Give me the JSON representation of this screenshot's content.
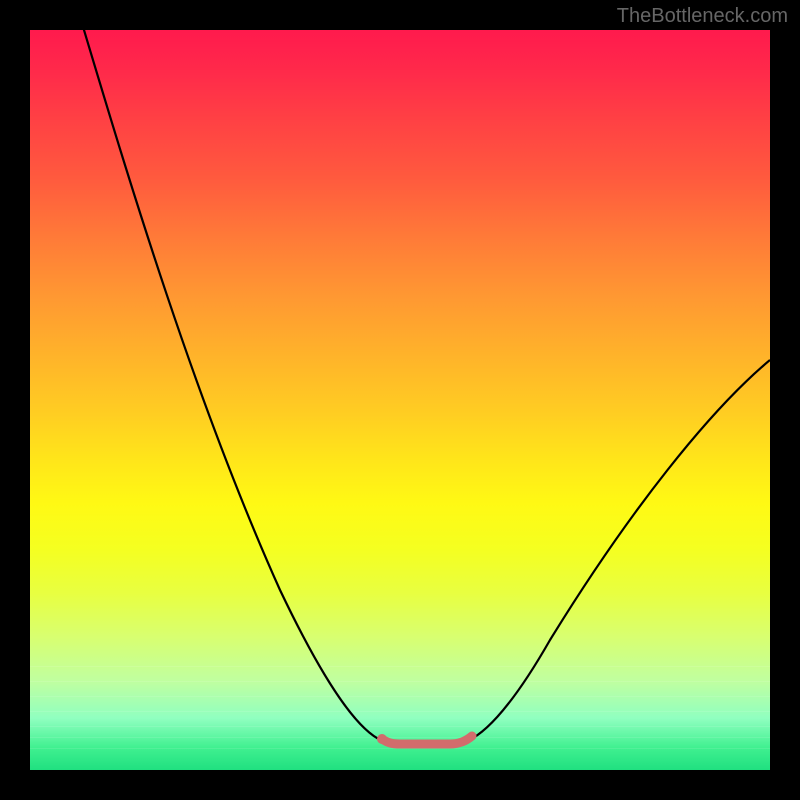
{
  "watermark": "TheBottleneck.com",
  "chart_data": {
    "type": "line",
    "title": "",
    "xlabel": "",
    "ylabel": "",
    "ylim": [
      0,
      100
    ],
    "x": [
      0.0,
      0.05,
      0.1,
      0.15,
      0.2,
      0.25,
      0.3,
      0.35,
      0.4,
      0.45,
      0.48,
      0.5,
      0.55,
      0.58,
      0.6,
      0.65,
      0.7,
      0.75,
      0.8,
      0.85,
      0.9,
      0.95,
      1.0
    ],
    "series": [
      {
        "name": "curve",
        "values": [
          120,
          100,
          84,
          68,
          54,
          42,
          31,
          22,
          14,
          8,
          4,
          3,
          3,
          4,
          6,
          11,
          18,
          26,
          35,
          44,
          52,
          58,
          62
        ]
      }
    ],
    "flat_zone": {
      "x_start": 0.48,
      "x_end": 0.58,
      "y": 3
    },
    "colors": {
      "curve": "#000000",
      "accent": "#d26c6c"
    }
  }
}
